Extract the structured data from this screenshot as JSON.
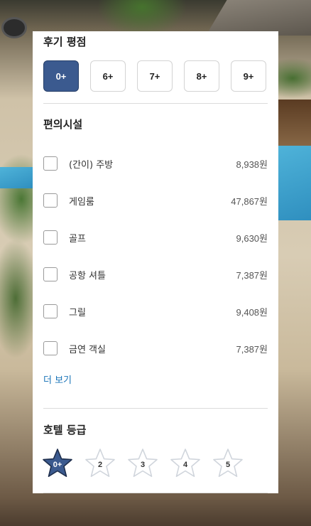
{
  "filters": {
    "review_rating": {
      "title": "후기 평점",
      "options": [
        "0+",
        "6+",
        "7+",
        "8+",
        "9+"
      ],
      "selected": "0+"
    },
    "amenities": {
      "title": "편의시설",
      "items": [
        {
          "label": "(간이) 주방",
          "price": "8,938원",
          "checked": false
        },
        {
          "label": "게임룸",
          "price": "47,867원",
          "checked": false
        },
        {
          "label": "골프",
          "price": "9,630원",
          "checked": false
        },
        {
          "label": "공항 셔틀",
          "price": "7,387원",
          "checked": false
        },
        {
          "label": "그릴",
          "price": "9,408원",
          "checked": false
        },
        {
          "label": "금연 객실",
          "price": "7,387원",
          "checked": false
        }
      ],
      "more_link": "더 보기"
    },
    "hotel_grade": {
      "title": "호텔 등급",
      "options": [
        "0+",
        "2",
        "3",
        "4",
        "5"
      ],
      "selected": "0+"
    }
  },
  "colors": {
    "accent": "#3b5a8f",
    "link": "#1a74b8",
    "star_outline": "#d0d5dc"
  }
}
